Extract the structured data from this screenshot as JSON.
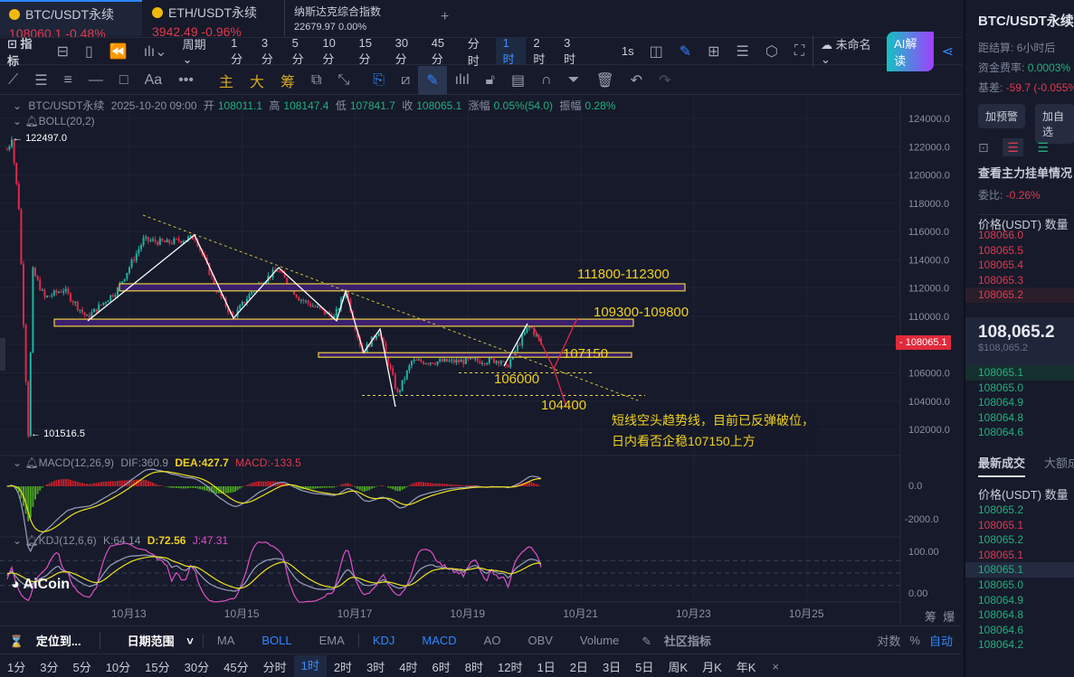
{
  "tabs": [
    {
      "name": "BTC/USDT永续",
      "price": "108060.1",
      "change": "-0.48%",
      "active": true
    },
    {
      "name": "ETH/USDT永续",
      "price": "3942.49",
      "change": "-0.96%"
    },
    {
      "name": "纳斯达克综合指数",
      "price": "22679.97",
      "change": "0.00%"
    }
  ],
  "add_tab": "+",
  "toolbar": {
    "indicators": "指标",
    "period": "周期",
    "intervals": [
      "1分",
      "3分",
      "5分",
      "10分",
      "15分",
      "30分",
      "45分",
      "分时",
      "1时",
      "2时",
      "3时"
    ],
    "active_interval": "1时",
    "seconds": "1s",
    "layout_name": "未命名",
    "ai": "AI解读"
  },
  "draw_tools": {
    "main": "主",
    "big": "大",
    "chip": "筹",
    "text": "Aa",
    "more": "•••"
  },
  "info": {
    "symbol": "BTC/USDT永续",
    "time": "2025-10-20 09:00",
    "open_l": "开",
    "open": "108011.1",
    "high_l": "高",
    "high": "108147.4",
    "low_l": "低",
    "low": "107841.7",
    "close_l": "收",
    "close": "108065.1",
    "chg_l": "涨幅",
    "chg": "0.05%(54.0)",
    "amp_l": "振幅",
    "amp": "0.28%",
    "boll": "BOLL(20,2)"
  },
  "macd": {
    "label": "MACD(12,26,9)",
    "dif": "DIF:360.9",
    "dea": "DEA:427.7",
    "macd": "MACD:-133.5",
    "axis": [
      "0.0",
      "-2000.0"
    ]
  },
  "kdj": {
    "label": "KDJ(12,6,6)",
    "k": "K:64.14",
    "d": "D:72.56",
    "j": "J:47.31",
    "axis": [
      "100.00",
      "0.00"
    ]
  },
  "logo": "AiCoin",
  "chart_data": {
    "type": "candlestick",
    "symbol": "BTC/USDT永续",
    "interval": "1h",
    "x_unit": "hours since 10月13 00:00",
    "ylim": [
      101000,
      125000
    ],
    "y_ticks": [
      "124000.0",
      "122000.0",
      "120000.0",
      "118000.0",
      "116000.0",
      "114000.0",
      "112000.0",
      "110000.0",
      "108000.0",
      "106000.0",
      "104000.0",
      "102000.0"
    ],
    "x_ticks": [
      "10月13",
      "10月15",
      "10月17",
      "10月19",
      "10月21",
      "10月23",
      "10月25"
    ],
    "current_price": "108065.1",
    "high_mark": "122497.0",
    "low_mark": "101516.5",
    "price_path": [
      [
        -52,
        121800
      ],
      [
        -50,
        122497
      ],
      [
        -47,
        117700
      ],
      [
        -43,
        101516
      ],
      [
        -41,
        113200
      ],
      [
        -36,
        111300
      ],
      [
        -28,
        111900
      ],
      [
        -18,
        109900
      ],
      [
        -5,
        111900
      ],
      [
        6,
        115400
      ],
      [
        16,
        115200
      ],
      [
        28,
        115600
      ],
      [
        37,
        111900
      ],
      [
        44,
        109900
      ],
      [
        53,
        112000
      ],
      [
        63,
        113300
      ],
      [
        72,
        111300
      ],
      [
        87,
        109900
      ],
      [
        92,
        111800
      ],
      [
        99,
        107400
      ],
      [
        106,
        109000
      ],
      [
        114,
        104500
      ],
      [
        120,
        106800
      ],
      [
        137,
        106800
      ],
      [
        158,
        106900
      ],
      [
        160,
        106300
      ],
      [
        170,
        109400
      ],
      [
        175,
        108065
      ]
    ],
    "zones": [
      {
        "label": "111800-112300",
        "from": 111800,
        "to": 112300
      },
      {
        "label": "109300-109800",
        "from": 109300,
        "to": 109800
      },
      {
        "label": "107150",
        "from": 107000,
        "to": 107300
      }
    ],
    "levels": [
      {
        "label": "106000",
        "value": 106000
      },
      {
        "label": "104400",
        "value": 104400
      }
    ],
    "note": [
      "短线空头趋势线，目前已反弹破位，",
      "日内看否企稳107150上方"
    ]
  },
  "bottom": {
    "locate": "定位到...",
    "range": "日期范围",
    "indicators": [
      "MA",
      "BOLL",
      "EMA",
      "KDJ",
      "MACD",
      "AO",
      "OBV",
      "Volume"
    ],
    "active": [
      "BOLL",
      "KDJ",
      "MACD"
    ],
    "community": "社区指标",
    "log": "对数",
    "pct": "%",
    "auto": "自动",
    "chip": "筹",
    "burst": "爆"
  },
  "intervals2": [
    "1分",
    "3分",
    "5分",
    "10分",
    "15分",
    "30分",
    "45分",
    "分时",
    "1时",
    "2时",
    "3时",
    "4时",
    "6时",
    "8时",
    "12时",
    "1日",
    "2日",
    "3日",
    "5日",
    "周K",
    "月K",
    "年K"
  ],
  "close": "×",
  "side": {
    "title": "BTC/USDT永续",
    "settle_l": "距结算:",
    "settle": "6小时后",
    "fund_l": "资金费率:",
    "fund": "0.0003%",
    "basis_l": "基差:",
    "basis": "-59.7 (-0.055%)",
    "alert": "加预警",
    "watch": "加自选",
    "book_title": "查看主力挂单情况",
    "ratio_l": "委比:",
    "ratio": "-0.26%",
    "col_price": "价格(USDT)",
    "col_qty": "数量",
    "asks": [
      "108066.0",
      "108065.5",
      "108065.4",
      "108065.3",
      "108065.2"
    ],
    "last": "108,065.2",
    "last_usd": "$108,065.2",
    "bids": [
      "108065.1",
      "108065.0",
      "108064.9",
      "108064.8",
      "108064.6"
    ],
    "trades_tab": "最新成交",
    "big_tab": "大额成交",
    "trades": [
      {
        "p": "108065.2",
        "s": "g"
      },
      {
        "p": "108065.1",
        "s": "r"
      },
      {
        "p": "108065.2",
        "s": "g"
      },
      {
        "p": "108065.1",
        "s": "r"
      },
      {
        "p": "108065.1",
        "s": "g"
      },
      {
        "p": "108065.0",
        "s": "g"
      },
      {
        "p": "108064.9",
        "s": "g"
      },
      {
        "p": "108064.8",
        "s": "g"
      },
      {
        "p": "108064.6",
        "s": "g"
      },
      {
        "p": "108064.2",
        "s": "g"
      }
    ]
  }
}
